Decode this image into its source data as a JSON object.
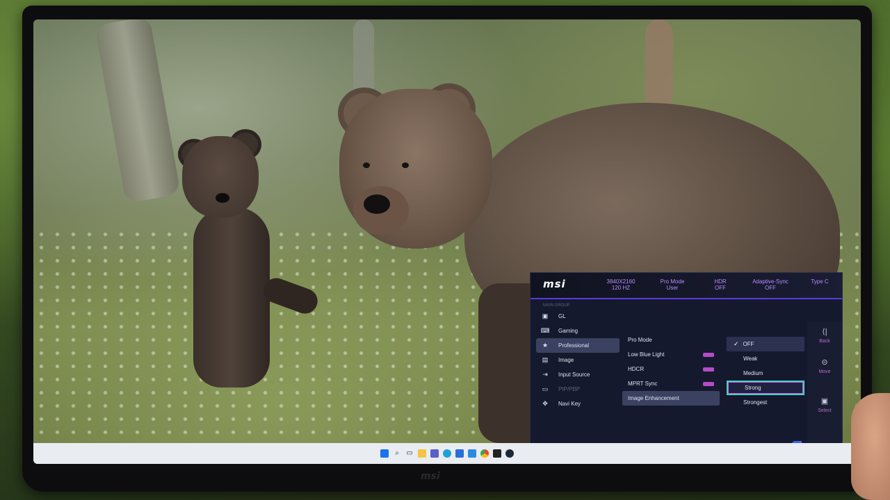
{
  "osd": {
    "brand": "msi",
    "status": [
      {
        "line1": "3840X2160",
        "line2": "120 HZ"
      },
      {
        "line1": "Pro Mode",
        "line2": "User"
      },
      {
        "line1": "HDR",
        "line2": "OFF"
      },
      {
        "line1": "Adaptive-Sync",
        "line2": "OFF"
      },
      {
        "line1": "Type C",
        "line2": ""
      }
    ],
    "breadcrumb": "MAIN GROUP",
    "menu": [
      {
        "label": "GL",
        "icon": "gl-icon",
        "state": "normal"
      },
      {
        "label": "Gaming",
        "icon": "gamepad-icon",
        "state": "normal"
      },
      {
        "label": "Professional",
        "icon": "star-icon",
        "state": "active"
      },
      {
        "label": "Image",
        "icon": "image-icon",
        "state": "normal"
      },
      {
        "label": "Input Source",
        "icon": "input-icon",
        "state": "normal"
      },
      {
        "label": "PIP/PBP",
        "icon": "pip-icon",
        "state": "disabled"
      },
      {
        "label": "Navi Key",
        "icon": "navi-key-icon",
        "state": "normal"
      }
    ],
    "submenu": [
      {
        "label": "Pro Mode",
        "tag": false,
        "active": false
      },
      {
        "label": "Low Blue Light",
        "tag": true,
        "active": false
      },
      {
        "label": "HDCR",
        "tag": true,
        "active": false
      },
      {
        "label": "MPRT Sync",
        "tag": true,
        "active": false
      },
      {
        "label": "Image Enhancement",
        "tag": false,
        "active": true
      }
    ],
    "options": [
      {
        "label": "OFF",
        "selected": true,
        "focus": false
      },
      {
        "label": "Weak",
        "selected": false,
        "focus": false
      },
      {
        "label": "Medium",
        "selected": false,
        "focus": false
      },
      {
        "label": "Strong",
        "selected": false,
        "focus": true
      },
      {
        "label": "Strongest",
        "selected": false,
        "focus": false
      }
    ],
    "actions": {
      "back": "Back",
      "move": "Move",
      "select": "Select"
    }
  },
  "monitor_logo": "msi",
  "taskbar": {
    "icons": [
      "windows-icon",
      "search-icon",
      "task-view-icon",
      "folder-icon",
      "teams-icon",
      "edge-icon",
      "store-icon",
      "mail-icon",
      "chrome-icon",
      "terminal-icon",
      "steam-icon"
    ]
  }
}
